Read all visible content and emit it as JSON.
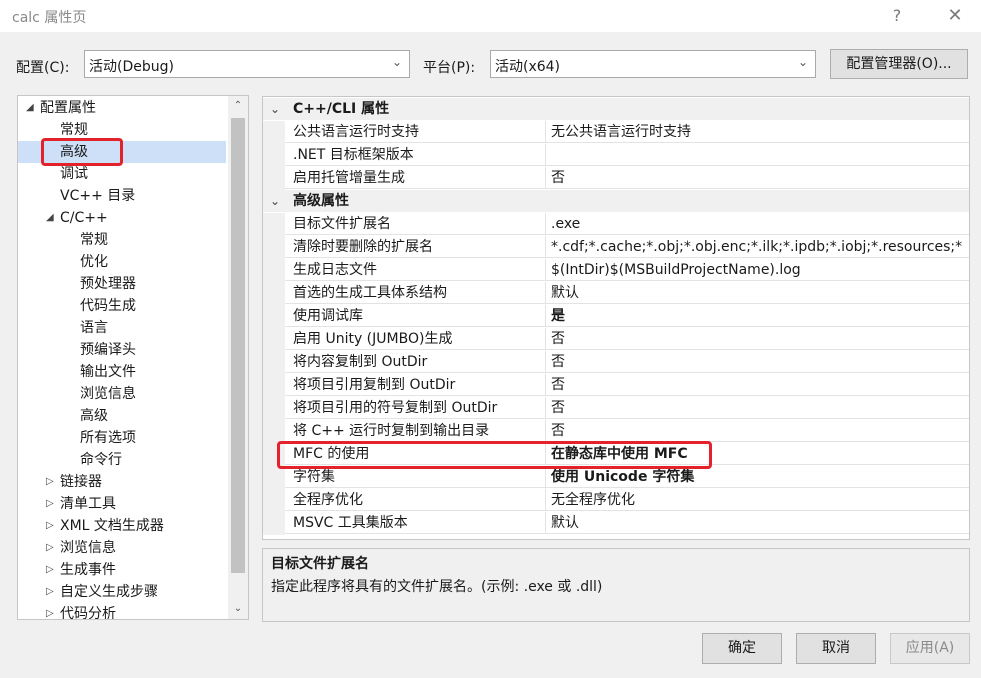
{
  "window": {
    "title": "calc 属性页",
    "help": "?",
    "close": "✕"
  },
  "config": {
    "config_label": "配置(C):",
    "config_value": "活动(Debug)",
    "platform_label": "平台(P):",
    "platform_value": "活动(x64)",
    "manager_button": "配置管理器(O)..."
  },
  "tree": {
    "items": [
      {
        "label": "配置属性",
        "toggle": "◢"
      },
      {
        "label": "常规"
      },
      {
        "label": "高级"
      },
      {
        "label": "调试"
      },
      {
        "label": "VC++ 目录"
      },
      {
        "label": "C/C++",
        "toggle": "◢"
      },
      {
        "label": "常规"
      },
      {
        "label": "优化"
      },
      {
        "label": "预处理器"
      },
      {
        "label": "代码生成"
      },
      {
        "label": "语言"
      },
      {
        "label": "预编译头"
      },
      {
        "label": "输出文件"
      },
      {
        "label": "浏览信息"
      },
      {
        "label": "高级"
      },
      {
        "label": "所有选项"
      },
      {
        "label": "命令行"
      },
      {
        "label": "链接器",
        "toggle": "▷"
      },
      {
        "label": "清单工具",
        "toggle": "▷"
      },
      {
        "label": "XML 文档生成器",
        "toggle": "▷"
      },
      {
        "label": "浏览信息",
        "toggle": "▷"
      },
      {
        "label": "生成事件",
        "toggle": "▷"
      },
      {
        "label": "自定义生成步骤",
        "toggle": "▷"
      },
      {
        "label": "代码分析",
        "toggle": "▷"
      }
    ],
    "scroll_up": "⌃",
    "scroll_down": "⌄"
  },
  "grid": {
    "sections": [
      {
        "title": "C++/CLI 属性",
        "chevron": "⌄",
        "rows": [
          {
            "name": "公共语言运行时支持",
            "value": "无公共语言运行时支持"
          },
          {
            "name": ".NET 目标框架版本",
            "value": ""
          },
          {
            "name": "启用托管增量生成",
            "value": "否"
          }
        ]
      },
      {
        "title": "高级属性",
        "chevron": "⌄",
        "rows": [
          {
            "name": "目标文件扩展名",
            "value": ".exe"
          },
          {
            "name": "清除时要删除的扩展名",
            "value": "*.cdf;*.cache;*.obj;*.obj.enc;*.ilk;*.ipdb;*.iobj;*.resources;*"
          },
          {
            "name": "生成日志文件",
            "value": "$(IntDir)$(MSBuildProjectName).log"
          },
          {
            "name": "首选的生成工具体系结构",
            "value": "默认"
          },
          {
            "name": "使用调试库",
            "value": "是"
          },
          {
            "name": "启用 Unity (JUMBO)生成",
            "value": "否"
          },
          {
            "name": "将内容复制到 OutDir",
            "value": "否"
          },
          {
            "name": "将项目引用复制到 OutDir",
            "value": "否"
          },
          {
            "name": "将项目引用的符号复制到 OutDir",
            "value": "否"
          },
          {
            "name": "将 C++ 运行时复制到输出目录",
            "value": "否"
          },
          {
            "name": "MFC 的使用",
            "value": "在静态库中使用 MFC"
          },
          {
            "name": "字符集",
            "value": "使用 Unicode 字符集"
          },
          {
            "name": "全程序优化",
            "value": "无全程序优化"
          },
          {
            "name": "MSVC 工具集版本",
            "value": "默认"
          }
        ]
      }
    ]
  },
  "description": {
    "title": "目标文件扩展名",
    "text": "指定此程序将具有的文件扩展名。(示例: .exe 或 .dll)"
  },
  "buttons": {
    "ok": "确定",
    "cancel": "取消",
    "apply": "应用(A)"
  },
  "colors": {
    "highlight": "#e3222c",
    "selection": "#cde0f7"
  }
}
